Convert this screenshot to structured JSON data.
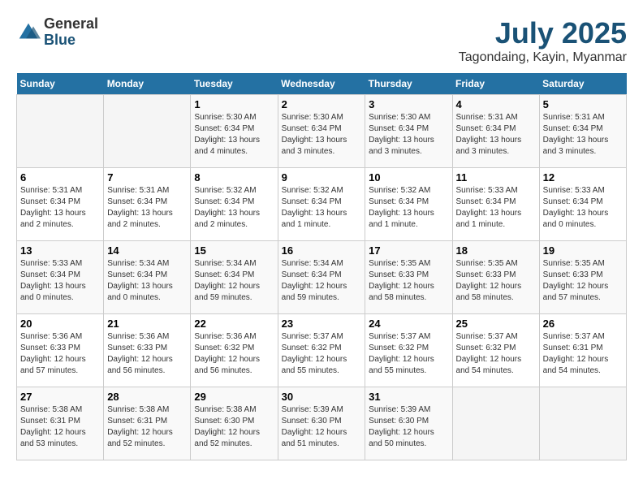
{
  "header": {
    "logo_general": "General",
    "logo_blue": "Blue",
    "month_year": "July 2025",
    "location": "Tagondaing, Kayin, Myanmar"
  },
  "weekdays": [
    "Sunday",
    "Monday",
    "Tuesday",
    "Wednesday",
    "Thursday",
    "Friday",
    "Saturday"
  ],
  "weeks": [
    [
      {
        "day": "",
        "detail": ""
      },
      {
        "day": "",
        "detail": ""
      },
      {
        "day": "1",
        "detail": "Sunrise: 5:30 AM\nSunset: 6:34 PM\nDaylight: 13 hours and 4 minutes."
      },
      {
        "day": "2",
        "detail": "Sunrise: 5:30 AM\nSunset: 6:34 PM\nDaylight: 13 hours and 3 minutes."
      },
      {
        "day": "3",
        "detail": "Sunrise: 5:30 AM\nSunset: 6:34 PM\nDaylight: 13 hours and 3 minutes."
      },
      {
        "day": "4",
        "detail": "Sunrise: 5:31 AM\nSunset: 6:34 PM\nDaylight: 13 hours and 3 minutes."
      },
      {
        "day": "5",
        "detail": "Sunrise: 5:31 AM\nSunset: 6:34 PM\nDaylight: 13 hours and 3 minutes."
      }
    ],
    [
      {
        "day": "6",
        "detail": "Sunrise: 5:31 AM\nSunset: 6:34 PM\nDaylight: 13 hours and 2 minutes."
      },
      {
        "day": "7",
        "detail": "Sunrise: 5:31 AM\nSunset: 6:34 PM\nDaylight: 13 hours and 2 minutes."
      },
      {
        "day": "8",
        "detail": "Sunrise: 5:32 AM\nSunset: 6:34 PM\nDaylight: 13 hours and 2 minutes."
      },
      {
        "day": "9",
        "detail": "Sunrise: 5:32 AM\nSunset: 6:34 PM\nDaylight: 13 hours and 1 minute."
      },
      {
        "day": "10",
        "detail": "Sunrise: 5:32 AM\nSunset: 6:34 PM\nDaylight: 13 hours and 1 minute."
      },
      {
        "day": "11",
        "detail": "Sunrise: 5:33 AM\nSunset: 6:34 PM\nDaylight: 13 hours and 1 minute."
      },
      {
        "day": "12",
        "detail": "Sunrise: 5:33 AM\nSunset: 6:34 PM\nDaylight: 13 hours and 0 minutes."
      }
    ],
    [
      {
        "day": "13",
        "detail": "Sunrise: 5:33 AM\nSunset: 6:34 PM\nDaylight: 13 hours and 0 minutes."
      },
      {
        "day": "14",
        "detail": "Sunrise: 5:34 AM\nSunset: 6:34 PM\nDaylight: 13 hours and 0 minutes."
      },
      {
        "day": "15",
        "detail": "Sunrise: 5:34 AM\nSunset: 6:34 PM\nDaylight: 12 hours and 59 minutes."
      },
      {
        "day": "16",
        "detail": "Sunrise: 5:34 AM\nSunset: 6:34 PM\nDaylight: 12 hours and 59 minutes."
      },
      {
        "day": "17",
        "detail": "Sunrise: 5:35 AM\nSunset: 6:33 PM\nDaylight: 12 hours and 58 minutes."
      },
      {
        "day": "18",
        "detail": "Sunrise: 5:35 AM\nSunset: 6:33 PM\nDaylight: 12 hours and 58 minutes."
      },
      {
        "day": "19",
        "detail": "Sunrise: 5:35 AM\nSunset: 6:33 PM\nDaylight: 12 hours and 57 minutes."
      }
    ],
    [
      {
        "day": "20",
        "detail": "Sunrise: 5:36 AM\nSunset: 6:33 PM\nDaylight: 12 hours and 57 minutes."
      },
      {
        "day": "21",
        "detail": "Sunrise: 5:36 AM\nSunset: 6:33 PM\nDaylight: 12 hours and 56 minutes."
      },
      {
        "day": "22",
        "detail": "Sunrise: 5:36 AM\nSunset: 6:32 PM\nDaylight: 12 hours and 56 minutes."
      },
      {
        "day": "23",
        "detail": "Sunrise: 5:37 AM\nSunset: 6:32 PM\nDaylight: 12 hours and 55 minutes."
      },
      {
        "day": "24",
        "detail": "Sunrise: 5:37 AM\nSunset: 6:32 PM\nDaylight: 12 hours and 55 minutes."
      },
      {
        "day": "25",
        "detail": "Sunrise: 5:37 AM\nSunset: 6:32 PM\nDaylight: 12 hours and 54 minutes."
      },
      {
        "day": "26",
        "detail": "Sunrise: 5:37 AM\nSunset: 6:31 PM\nDaylight: 12 hours and 54 minutes."
      }
    ],
    [
      {
        "day": "27",
        "detail": "Sunrise: 5:38 AM\nSunset: 6:31 PM\nDaylight: 12 hours and 53 minutes."
      },
      {
        "day": "28",
        "detail": "Sunrise: 5:38 AM\nSunset: 6:31 PM\nDaylight: 12 hours and 52 minutes."
      },
      {
        "day": "29",
        "detail": "Sunrise: 5:38 AM\nSunset: 6:30 PM\nDaylight: 12 hours and 52 minutes."
      },
      {
        "day": "30",
        "detail": "Sunrise: 5:39 AM\nSunset: 6:30 PM\nDaylight: 12 hours and 51 minutes."
      },
      {
        "day": "31",
        "detail": "Sunrise: 5:39 AM\nSunset: 6:30 PM\nDaylight: 12 hours and 50 minutes."
      },
      {
        "day": "",
        "detail": ""
      },
      {
        "day": "",
        "detail": ""
      }
    ]
  ]
}
